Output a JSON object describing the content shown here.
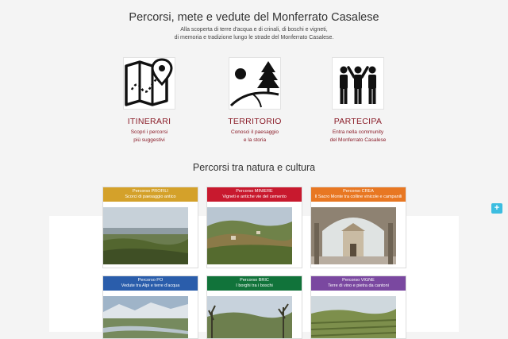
{
  "header": {
    "title": "Percorsi, mete e vedute del Monferrato Casalese",
    "subtitle_lines": [
      "Alla scoperta di terre d'acqua e di crinali, di boschi e vigneti,",
      "di memoria e tradizione lungo le strade del Monferrato Casalese."
    ]
  },
  "features": [
    {
      "title": "ITINERARI",
      "desc": [
        "Scopri i percorsi",
        "più suggestivi"
      ],
      "icon": "map-pin-icon"
    },
    {
      "title": "TERRITORIO",
      "desc": [
        "Conosci il paesaggio",
        "e la storia"
      ],
      "icon": "landscape-icon"
    },
    {
      "title": "PARTECIPA",
      "desc": [
        "Entra nella community",
        "del Monferrato Casalese"
      ],
      "icon": "people-icon"
    }
  ],
  "section": {
    "title": "Percorsi tra natura e cultura"
  },
  "cards": [
    {
      "name": "Percorso PROFILI",
      "desc": "Scorci di paesaggio antico",
      "color": "#d4a12a"
    },
    {
      "name": "Percorso MINIERE",
      "desc": "Vigneti e antiche vie del cemento",
      "color": "#c8192e"
    },
    {
      "name": "Percorso CREA",
      "desc": "Il Sacro Monte tra colline vinicole e campanili",
      "color": "#e87722"
    },
    {
      "name": "Percorso PO",
      "desc": "Vedute tra Alpi e terre d'acqua",
      "color": "#2a5dab"
    },
    {
      "name": "Percorso BRIC",
      "desc": "I borghi tra i boschi",
      "color": "#11733a"
    },
    {
      "name": "Percorso VIGNE",
      "desc": "Terre di vino e pietra da cantoni",
      "color": "#7a48a0"
    }
  ],
  "floating_button": {
    "label": "+"
  },
  "colors": {
    "accent": "#8a1c28",
    "button": "#3cbde0"
  }
}
